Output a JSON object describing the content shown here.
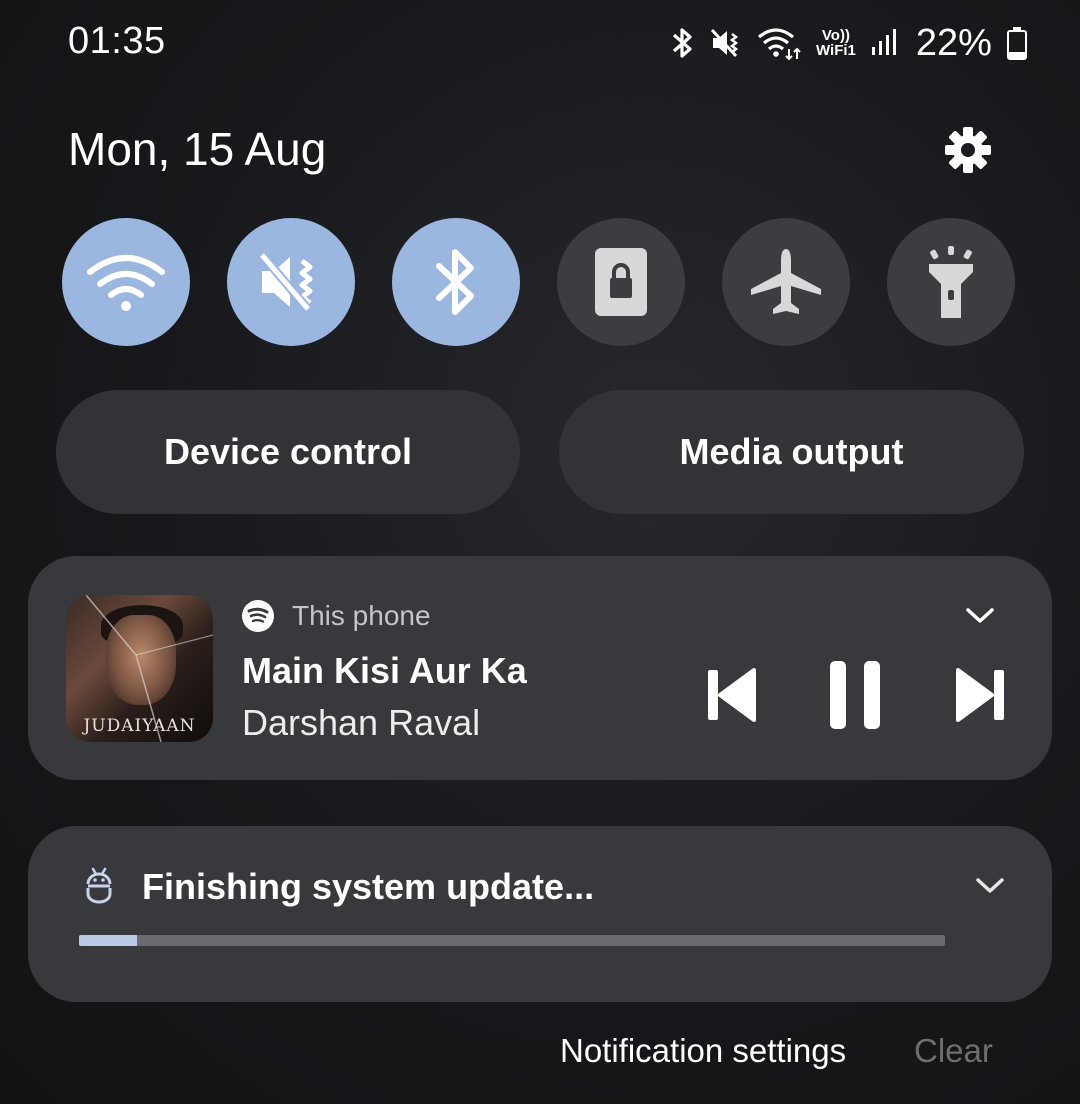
{
  "status_bar": {
    "time": "01:35",
    "battery_percent": "22%",
    "icons": [
      "bluetooth-icon",
      "mute-vibrate-icon",
      "wifi-data-icon",
      "vowifi-icon",
      "signal-icon",
      "battery-icon"
    ],
    "vowifi_top": "Vo))",
    "vowifi_bottom": "WiFi1"
  },
  "header": {
    "date": "Mon, 15 Aug",
    "settings_icon": "gear-icon"
  },
  "quick_toggles": [
    {
      "name": "wifi",
      "icon": "wifi-icon",
      "state": "on"
    },
    {
      "name": "sound",
      "icon": "mute-vibrate-icon",
      "state": "on"
    },
    {
      "name": "bluetooth",
      "icon": "bluetooth-icon",
      "state": "on"
    },
    {
      "name": "screen-lock",
      "icon": "lock-screen-icon",
      "state": "off"
    },
    {
      "name": "airplane-mode",
      "icon": "airplane-icon",
      "state": "off"
    },
    {
      "name": "flashlight",
      "icon": "flashlight-icon",
      "state": "off"
    }
  ],
  "pills": {
    "device_control": "Device control",
    "media_output": "Media output"
  },
  "media": {
    "source": "This phone",
    "source_icon": "spotify-icon",
    "title": "Main Kisi Aur Ka",
    "artist": "Darshan Raval",
    "album_art_text": "JUDAIYAAN",
    "controls": [
      "previous-icon",
      "pause-icon",
      "next-icon"
    ]
  },
  "update": {
    "text": "Finishing system update...",
    "progress": 0.067
  },
  "footer": {
    "notification_settings": "Notification settings",
    "clear": "Clear"
  },
  "colors": {
    "toggle_on": "#9bb7e0",
    "toggle_off": "#3c3d41",
    "card": "#38393c",
    "progress_fill": "#b9c9e6"
  }
}
